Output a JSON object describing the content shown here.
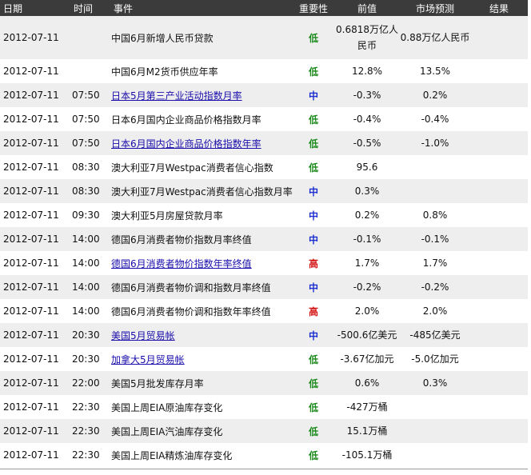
{
  "header": {
    "date": "日期",
    "time": "时间",
    "event": "事件",
    "importance": "重要性",
    "previous": "前值",
    "forecast": "市场预测",
    "result": "结果"
  },
  "colors": {
    "header_bg": "#3b3b3b",
    "row_alt_bg": "#eeeeee",
    "link": "#1a0dab",
    "low": "#1a8a1a",
    "mid": "#1d2fd0",
    "high": "#d21010"
  },
  "rows": [
    {
      "date": "2012-07-11",
      "time": "",
      "event": "中国6月新增人民币贷款",
      "link": false,
      "importance": "低",
      "level": "low",
      "previous": "0.6818万亿人民币",
      "forecast": "0.88万亿人民币",
      "result": ""
    },
    {
      "date": "2012-07-11",
      "time": "",
      "event": "中国6月M2货币供应年率",
      "link": false,
      "importance": "低",
      "level": "low",
      "previous": "12.8%",
      "forecast": "13.5%",
      "result": ""
    },
    {
      "date": "2012-07-11",
      "time": "07:50",
      "event": "日本5月第三产业活动指数月率",
      "link": true,
      "importance": "中",
      "level": "mid",
      "previous": "-0.3%",
      "forecast": "0.2%",
      "result": ""
    },
    {
      "date": "2012-07-11",
      "time": "07:50",
      "event": "日本6月国内企业商品价格指数月率",
      "link": false,
      "importance": "低",
      "level": "low",
      "previous": "-0.4%",
      "forecast": "-0.4%",
      "result": ""
    },
    {
      "date": "2012-07-11",
      "time": "07:50",
      "event": "日本6月国内企业商品价格指数年率",
      "link": true,
      "importance": "低",
      "level": "low",
      "previous": "-0.5%",
      "forecast": "-1.0%",
      "result": ""
    },
    {
      "date": "2012-07-11",
      "time": "08:30",
      "event": "澳大利亚7月Westpac消费者信心指数",
      "link": false,
      "importance": "低",
      "level": "low",
      "previous": "95.6",
      "forecast": "",
      "result": ""
    },
    {
      "date": "2012-07-11",
      "time": "08:30",
      "event": "澳大利亚7月Westpac消费者信心指数月率",
      "link": false,
      "importance": "中",
      "level": "mid",
      "previous": "0.3%",
      "forecast": "",
      "result": ""
    },
    {
      "date": "2012-07-11",
      "time": "09:30",
      "event": "澳大利亚5月房屋贷款月率",
      "link": false,
      "importance": "中",
      "level": "mid",
      "previous": "0.2%",
      "forecast": "0.8%",
      "result": ""
    },
    {
      "date": "2012-07-11",
      "time": "14:00",
      "event": "德国6月消费者物价指数月率终值",
      "link": false,
      "importance": "中",
      "level": "mid",
      "previous": "-0.1%",
      "forecast": "-0.1%",
      "result": ""
    },
    {
      "date": "2012-07-11",
      "time": "14:00",
      "event": "德国6月消费者物价指数年率终值",
      "link": true,
      "importance": "高",
      "level": "high",
      "previous": "1.7%",
      "forecast": "1.7%",
      "result": ""
    },
    {
      "date": "2012-07-11",
      "time": "14:00",
      "event": "德国6月消费者物价调和指数月率终值",
      "link": false,
      "importance": "中",
      "level": "mid",
      "previous": "-0.2%",
      "forecast": "-0.2%",
      "result": ""
    },
    {
      "date": "2012-07-11",
      "time": "14:00",
      "event": "德国6月消费者物价调和指数年率终值",
      "link": false,
      "importance": "高",
      "level": "high",
      "previous": "2.0%",
      "forecast": "2.0%",
      "result": ""
    },
    {
      "date": "2012-07-11",
      "time": "20:30",
      "event": "美国5月贸易帐",
      "link": true,
      "importance": "中",
      "level": "mid",
      "previous": "-500.6亿美元",
      "forecast": "-485亿美元",
      "result": ""
    },
    {
      "date": "2012-07-11",
      "time": "20:30",
      "event": "加拿大5月贸易帐",
      "link": true,
      "importance": "低",
      "level": "low",
      "previous": "-3.67亿加元",
      "forecast": "-5.0亿加元",
      "result": ""
    },
    {
      "date": "2012-07-11",
      "time": "22:00",
      "event": "美国5月批发库存月率",
      "link": false,
      "importance": "低",
      "level": "low",
      "previous": "0.6%",
      "forecast": "0.3%",
      "result": ""
    },
    {
      "date": "2012-07-11",
      "time": "22:30",
      "event": "美国上周EIA原油库存变化",
      "link": false,
      "importance": "低",
      "level": "low",
      "previous": "-427万桶",
      "forecast": "",
      "result": ""
    },
    {
      "date": "2012-07-11",
      "time": "22:30",
      "event": "美国上周EIA汽油库存变化",
      "link": false,
      "importance": "低",
      "level": "low",
      "previous": "15.1万桶",
      "forecast": "",
      "result": ""
    },
    {
      "date": "2012-07-11",
      "time": "22:30",
      "event": "美国上周EIA精炼油库存变化",
      "link": false,
      "importance": "低",
      "level": "low",
      "previous": "-105.1万桶",
      "forecast": "",
      "result": ""
    }
  ]
}
